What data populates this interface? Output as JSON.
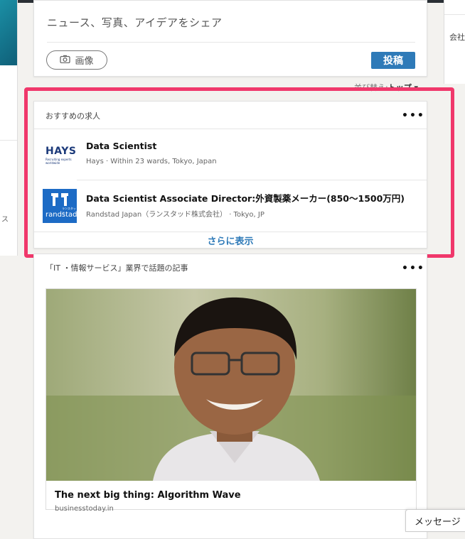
{
  "share": {
    "prompt": "ニュース、写真、アイデアをシェア",
    "photo_label": "画像",
    "post_label": "投稿"
  },
  "right_panel": {
    "label": "会社"
  },
  "left_panel": {
    "label": "ス"
  },
  "sort": {
    "prefix": "並び替え:",
    "value": "トップ ▾"
  },
  "jobs": {
    "title": "おすすめの求人",
    "items": [
      {
        "title": "Data Scientist",
        "meta": "Hays · Within 23 wards, Tokyo, Japan",
        "logo": {
          "name": "HAYS",
          "tagline": "Recruiting experts worldwide"
        }
      },
      {
        "title": "Data Scientist Associate Director:外資製薬メーカー(850〜1500万円)",
        "meta": "Randstad Japan（ランスタッド株式会社） · Tokyo, JP",
        "logo": {
          "name": "randstad",
          "tagline": "ランスタッド"
        }
      }
    ],
    "more_label": "さらに表示"
  },
  "news": {
    "title": "「IT ・情報サービス」業界で話題の記事",
    "article": {
      "title": "The next big thing: Algorithm Wave",
      "source": "businesstoday.in"
    }
  },
  "messaging": {
    "label": "メッセージ"
  },
  "colors": {
    "accent_blue": "#2e7ab8",
    "highlight_pink": "#f0386b",
    "randstad_blue": "#1d6bc5",
    "hays_navy": "#1c3a7a"
  }
}
